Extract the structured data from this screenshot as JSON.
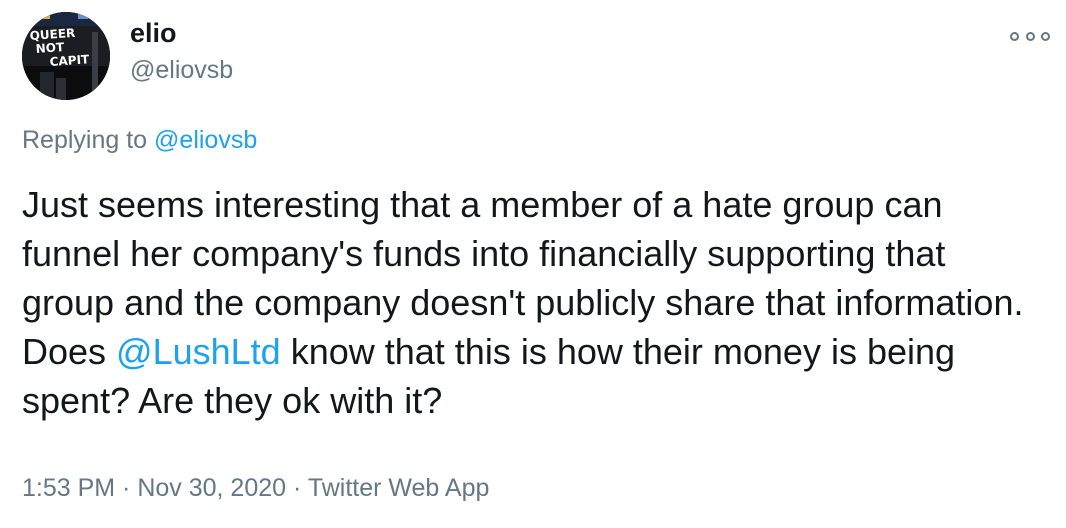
{
  "user": {
    "name": "elio",
    "handle": "@eliovsb",
    "avatar_sign_lines": [
      "QUEER",
      "NOT",
      "CAPIT"
    ]
  },
  "reply": {
    "prefix": "Replying to",
    "mention": "@eliovsb"
  },
  "tweet": {
    "text_before": "Just seems interesting that a member of a hate group can funnel her company's funds into financially supporting that group and the company doesn't publicly share that information. Does ",
    "mention": "@LushLtd",
    "text_after": " know that this is how their money is being spent? Are they ok with it?"
  },
  "meta": {
    "time": "1:53 PM",
    "separator1": " · ",
    "date": "Nov 30, 2020",
    "separator2": " · ",
    "source": "Twitter Web App"
  },
  "more_icon": "ellipsis-icon",
  "colors": {
    "text": "#14171a",
    "secondary": "#657786",
    "link": "#1da1f2"
  }
}
